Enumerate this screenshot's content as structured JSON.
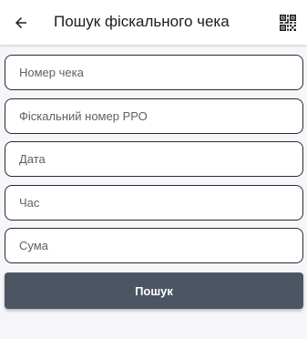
{
  "app_bar": {
    "back_icon": "arrow-left-icon",
    "title": "Пошук фіскального чека",
    "qr_icon": "qr-code-icon"
  },
  "form": {
    "fields": [
      {
        "placeholder": "Номер чека",
        "value": ""
      },
      {
        "placeholder": "Фіскальний номер РРО",
        "value": ""
      },
      {
        "placeholder": "Дата",
        "value": ""
      },
      {
        "placeholder": "Час",
        "value": ""
      },
      {
        "placeholder": "Сума",
        "value": ""
      }
    ],
    "submit_label": "Пошук"
  },
  "colors": {
    "background": "#f6f5fa",
    "app_bar": "#ffffff",
    "button": "#4c5563",
    "field_border": "#2b2b2b"
  }
}
